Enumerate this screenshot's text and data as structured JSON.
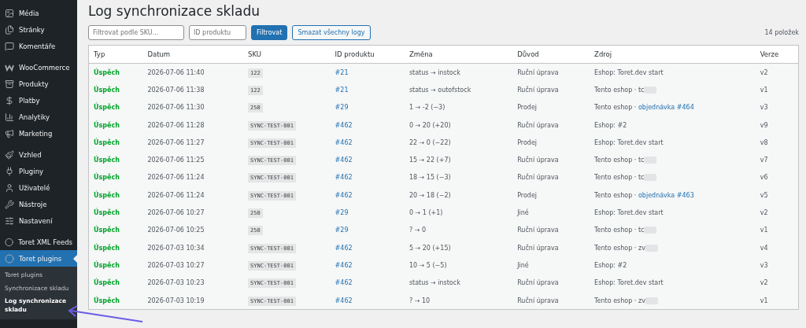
{
  "sidebar": {
    "groups": [
      [
        {
          "label": "Média",
          "selected": false
        },
        {
          "label": "Stránky",
          "selected": false
        },
        {
          "label": "Komentáře",
          "selected": false
        }
      ],
      [
        {
          "label": "WooCommerce",
          "selected": false
        },
        {
          "label": "Produkty",
          "selected": false
        },
        {
          "label": "Platby",
          "selected": false
        },
        {
          "label": "Analytiky",
          "selected": false
        },
        {
          "label": "Marketing",
          "selected": false
        }
      ],
      [
        {
          "label": "Vzhled",
          "selected": false
        },
        {
          "label": "Pluginy",
          "selected": false
        },
        {
          "label": "Uživatelé",
          "selected": false
        },
        {
          "label": "Nástroje",
          "selected": false
        },
        {
          "label": "Nastavení",
          "selected": false
        }
      ],
      [
        {
          "label": "Toret XML Feeds",
          "selected": false
        },
        {
          "label": "Toret plugins",
          "selected": true
        }
      ]
    ],
    "submenu": [
      {
        "label": "Toret plugins",
        "selected": false
      },
      {
        "label": "Synchronizace skladu",
        "selected": false
      },
      {
        "label": "Log synchronizace skladu",
        "selected": true
      }
    ]
  },
  "page": {
    "title": "Log synchronizace skladu",
    "sku_filter": {
      "placeholder": "Filtrovat podle SKU..."
    },
    "id_filter": {
      "placeholder": "ID produktu"
    },
    "filter_button": "Filtrovat",
    "delete_button": "Smazat všechny logy",
    "count": "14 položek"
  },
  "table": {
    "columns": [
      "Typ",
      "Datum",
      "SKU",
      "ID produktu",
      "Změna",
      "Důvod",
      "Zdroj",
      "Verze"
    ],
    "rows": [
      {
        "type": "Úspěch",
        "date": "2026-07-06 11:40",
        "sku": "122",
        "product": "#21",
        "change": "status → instock",
        "reason": "Ruční úprava",
        "source": {
          "text": "Eshop: Toret.dev start"
        },
        "version": "v2"
      },
      {
        "type": "Úspěch",
        "date": "2026-07-06 11:38",
        "sku": "122",
        "product": "#21",
        "change": "status → outofstock",
        "reason": "Ruční úprava",
        "source": {
          "text": "Tento eshop · tc",
          "redacted": true
        },
        "version": "v1"
      },
      {
        "type": "Úspěch",
        "date": "2026-07-06 11:30",
        "sku": "250",
        "product": "#29",
        "change": "1 → -2 (−3)",
        "reason": "Prodej",
        "source": {
          "text": "Tento eshop · ",
          "link": "objednávka #464"
        },
        "version": "v3"
      },
      {
        "type": "Úspěch",
        "date": "2026-07-06 11:28",
        "sku": "SYNC-TEST-001",
        "product": "#462",
        "change": "0 → 20 (+20)",
        "reason": "Ruční úprava",
        "source": {
          "text": "Eshop: #2"
        },
        "version": "v9"
      },
      {
        "type": "Úspěch",
        "date": "2026-07-06 11:27",
        "sku": "SYNC-TEST-001",
        "product": "#462",
        "change": "22 → 0 (−22)",
        "reason": "Prodej",
        "source": {
          "text": "Eshop: Toret.dev start"
        },
        "version": "v8"
      },
      {
        "type": "Úspěch",
        "date": "2026-07-06 11:25",
        "sku": "SYNC-TEST-001",
        "product": "#462",
        "change": "15 → 22 (+7)",
        "reason": "Ruční úprava",
        "source": {
          "text": "Tento eshop · tc",
          "redacted": true
        },
        "version": "v7"
      },
      {
        "type": "Úspěch",
        "date": "2026-07-06 11:24",
        "sku": "SYNC-TEST-001",
        "product": "#462",
        "change": "18 → 15 (−3)",
        "reason": "Ruční úprava",
        "source": {
          "text": "Tento eshop · tc",
          "redacted": true
        },
        "version": "v6"
      },
      {
        "type": "Úspěch",
        "date": "2026-07-06 11:24",
        "sku": "SYNC-TEST-001",
        "product": "#462",
        "change": "20 → 18 (−2)",
        "reason": "Prodej",
        "source": {
          "text": "Tento eshop · ",
          "link": "objednávka #463"
        },
        "version": "v5"
      },
      {
        "type": "Úspěch",
        "date": "2026-07-06 10:27",
        "sku": "250",
        "product": "#29",
        "change": "0 → 1 (+1)",
        "reason": "Jiné",
        "source": {
          "text": "Eshop: Toret.dev start"
        },
        "version": "v2"
      },
      {
        "type": "Úspěch",
        "date": "2026-07-06 10:25",
        "sku": "250",
        "product": "#29",
        "change": "? → 0",
        "reason": "Ruční úprava",
        "source": {
          "text": "Tento eshop · tc",
          "redacted": true
        },
        "version": "v1"
      },
      {
        "type": "Úspěch",
        "date": "2026-07-03 10:34",
        "sku": "SYNC-TEST-001",
        "product": "#462",
        "change": "5 → 20 (+15)",
        "reason": "Ruční úprava",
        "source": {
          "text": "Tento eshop · zv",
          "redacted": true
        },
        "version": "v4"
      },
      {
        "type": "Úspěch",
        "date": "2026-07-03 10:27",
        "sku": "SYNC-TEST-001",
        "product": "#462",
        "change": "10 → 5 (−5)",
        "reason": "Jiné",
        "source": {
          "text": "Eshop: #2"
        },
        "version": "v3"
      },
      {
        "type": "Úspěch",
        "date": "2026-07-03 10:23",
        "sku": "SYNC-TEST-001",
        "product": "#462",
        "change": "status → instock",
        "reason": "Ruční úprava",
        "source": {
          "text": "Eshop: Toret.dev start"
        },
        "version": "v2"
      },
      {
        "type": "Úspěch",
        "date": "2026-07-03 10:19",
        "sku": "SYNC-TEST-001",
        "product": "#462",
        "change": "? → 10",
        "reason": "Ruční úprava",
        "source": {
          "text": "Tento eshop · zv",
          "redacted": true
        },
        "version": "v1"
      }
    ]
  }
}
